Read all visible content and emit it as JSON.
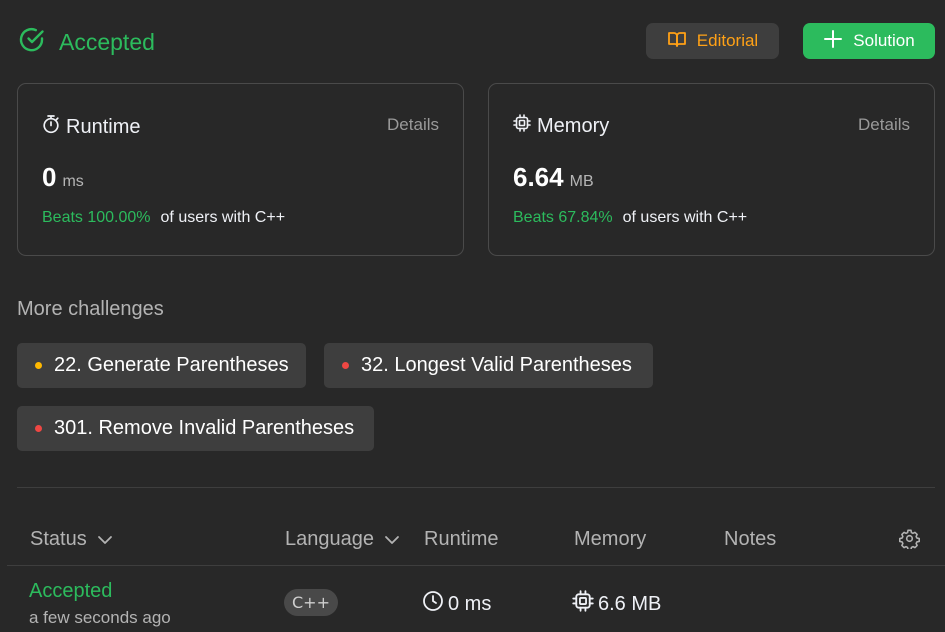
{
  "header": {
    "status": "Accepted",
    "editorial_label": "Editorial",
    "solution_label": "Solution",
    "colors": {
      "accepted": "#2cbb5d",
      "editorial": "#ffa116"
    }
  },
  "runtime_card": {
    "title": "Runtime",
    "details": "Details",
    "value": "0",
    "unit": "ms",
    "beats": "Beats 100.00%",
    "suffix": "of users with C++"
  },
  "memory_card": {
    "title": "Memory",
    "details": "Details",
    "value": "6.64",
    "unit": "MB",
    "beats": "Beats 67.84%",
    "suffix": "of users with C++"
  },
  "challenges": {
    "title": "More challenges",
    "items": [
      {
        "label": "22. Generate Parentheses",
        "difficulty_color": "#ffb800"
      },
      {
        "label": "32. Longest Valid Parentheses",
        "difficulty_color": "#ef4743"
      },
      {
        "label": "301. Remove Invalid Parentheses",
        "difficulty_color": "#ef4743"
      }
    ]
  },
  "table": {
    "headers": {
      "status": "Status",
      "language": "Language",
      "runtime": "Runtime",
      "memory": "Memory",
      "notes": "Notes"
    },
    "row": {
      "status": "Accepted",
      "time": "a few seconds ago",
      "language": "C++",
      "runtime": "0 ms",
      "memory": "6.6 MB"
    }
  }
}
